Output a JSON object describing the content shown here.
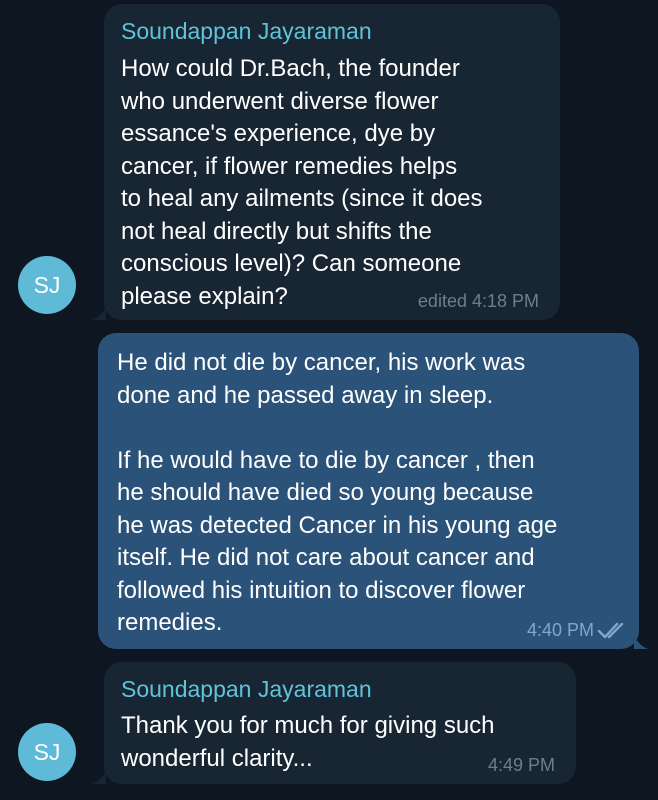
{
  "messages": [
    {
      "sender": "Soundappan Jayaraman",
      "avatar_initials": "SJ",
      "text": "How could Dr.Bach, the founder\nwho underwent diverse flower\nessance's experience, dye by\ncancer, if flower remedies helps\nto heal any ailments (since it does\nnot heal directly but shifts the\nconscious level)? Can someone\nplease explain?",
      "meta": "edited 4:18 PM"
    },
    {
      "text": "He did not die by cancer, his work was\ndone and he passed away in sleep.\n\nIf he would have to die by cancer , then\nhe should have died so young because\nhe was detected Cancer in his young age\nitself. He did not care about cancer and\nfollowed his intuition to discover flower\nremedies.",
      "time": "4:40 PM",
      "status_icon": "double-check-icon"
    },
    {
      "sender": "Soundappan Jayaraman",
      "avatar_initials": "SJ",
      "text": "Thank you for much for giving such\nwonderful clarity...",
      "time": "4:49 PM"
    }
  ],
  "colors": {
    "background": "#0e1621",
    "incoming_bubble": "#182533",
    "outgoing_bubble": "#2b5278",
    "sender_name": "#5fc4d9",
    "avatar": "#5ebad6"
  }
}
